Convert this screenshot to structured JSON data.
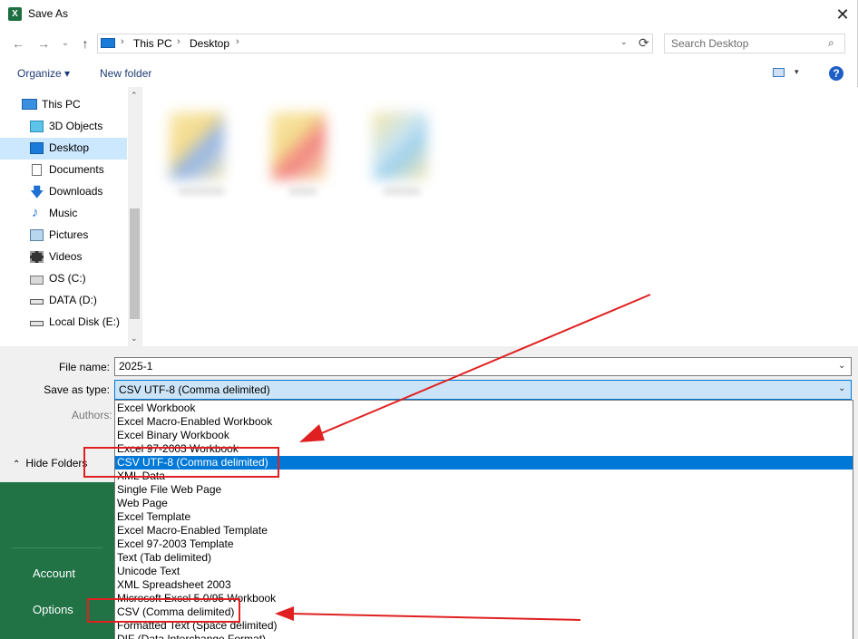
{
  "dialog": {
    "title": "Save As",
    "app_icon_letter": "X",
    "close_glyph": "✕"
  },
  "nav_buttons": {
    "back": "←",
    "forward": "→",
    "recent": "⌄",
    "up": "↑"
  },
  "address": {
    "crumbs": [
      "This PC",
      "Desktop"
    ],
    "separator": "›",
    "dropdown": "⌄",
    "refresh": "⟳"
  },
  "search": {
    "placeholder": "Search Desktop",
    "icon": "⌕"
  },
  "toolbar": {
    "organize_label": "Organize ▾",
    "new_folder_label": "New folder",
    "view_dropdown": "▾",
    "help_label": "?"
  },
  "sidebar": {
    "items": [
      {
        "label": "This PC",
        "icon": "pc-icon"
      },
      {
        "label": "3D Objects",
        "icon": "cube-icon"
      },
      {
        "label": "Desktop",
        "icon": "desktop-icon",
        "selected": true
      },
      {
        "label": "Documents",
        "icon": "document-icon"
      },
      {
        "label": "Downloads",
        "icon": "download-icon"
      },
      {
        "label": "Music",
        "icon": "music-icon"
      },
      {
        "label": "Pictures",
        "icon": "picture-icon"
      },
      {
        "label": "Videos",
        "icon": "video-icon"
      },
      {
        "label": "OS (C:)",
        "icon": "drive-icon"
      },
      {
        "label": "DATA (D:)",
        "icon": "drive-icon"
      },
      {
        "label": "Local Disk (E:)",
        "icon": "drive-icon"
      }
    ],
    "scroll_up": "⌃",
    "scroll_down": "⌄"
  },
  "form": {
    "filename_label": "File name:",
    "filename_value": "2025-1",
    "type_label": "Save as type:",
    "type_value": "CSV UTF-8 (Comma delimited)",
    "authors_label": "Authors:",
    "dropdown_glyph": "⌄",
    "hide_folders_label": "Hide Folders",
    "hide_chevron": "⌃"
  },
  "type_options": [
    "Excel Workbook",
    "Excel Macro-Enabled Workbook",
    "Excel Binary Workbook",
    "Excel 97-2003 Workbook",
    "CSV UTF-8 (Comma delimited)",
    "XML Data",
    "Single File Web Page",
    "Web Page",
    "Excel Template",
    "Excel Macro-Enabled Template",
    "Excel 97-2003 Template",
    "Text (Tab delimited)",
    "Unicode Text",
    "XML Spreadsheet 2003",
    "Microsoft Excel 5.0/95 Workbook",
    "CSV (Comma delimited)",
    "Formatted Text (Space delimited)",
    "DIF (Data Interchange Format)"
  ],
  "selected_type_index": 4,
  "backstage": {
    "account_label": "Account",
    "options_label": "Options"
  },
  "colors": {
    "excel_green": "#217346",
    "selection_blue": "#0078d7",
    "annotation_red": "#e02020"
  }
}
